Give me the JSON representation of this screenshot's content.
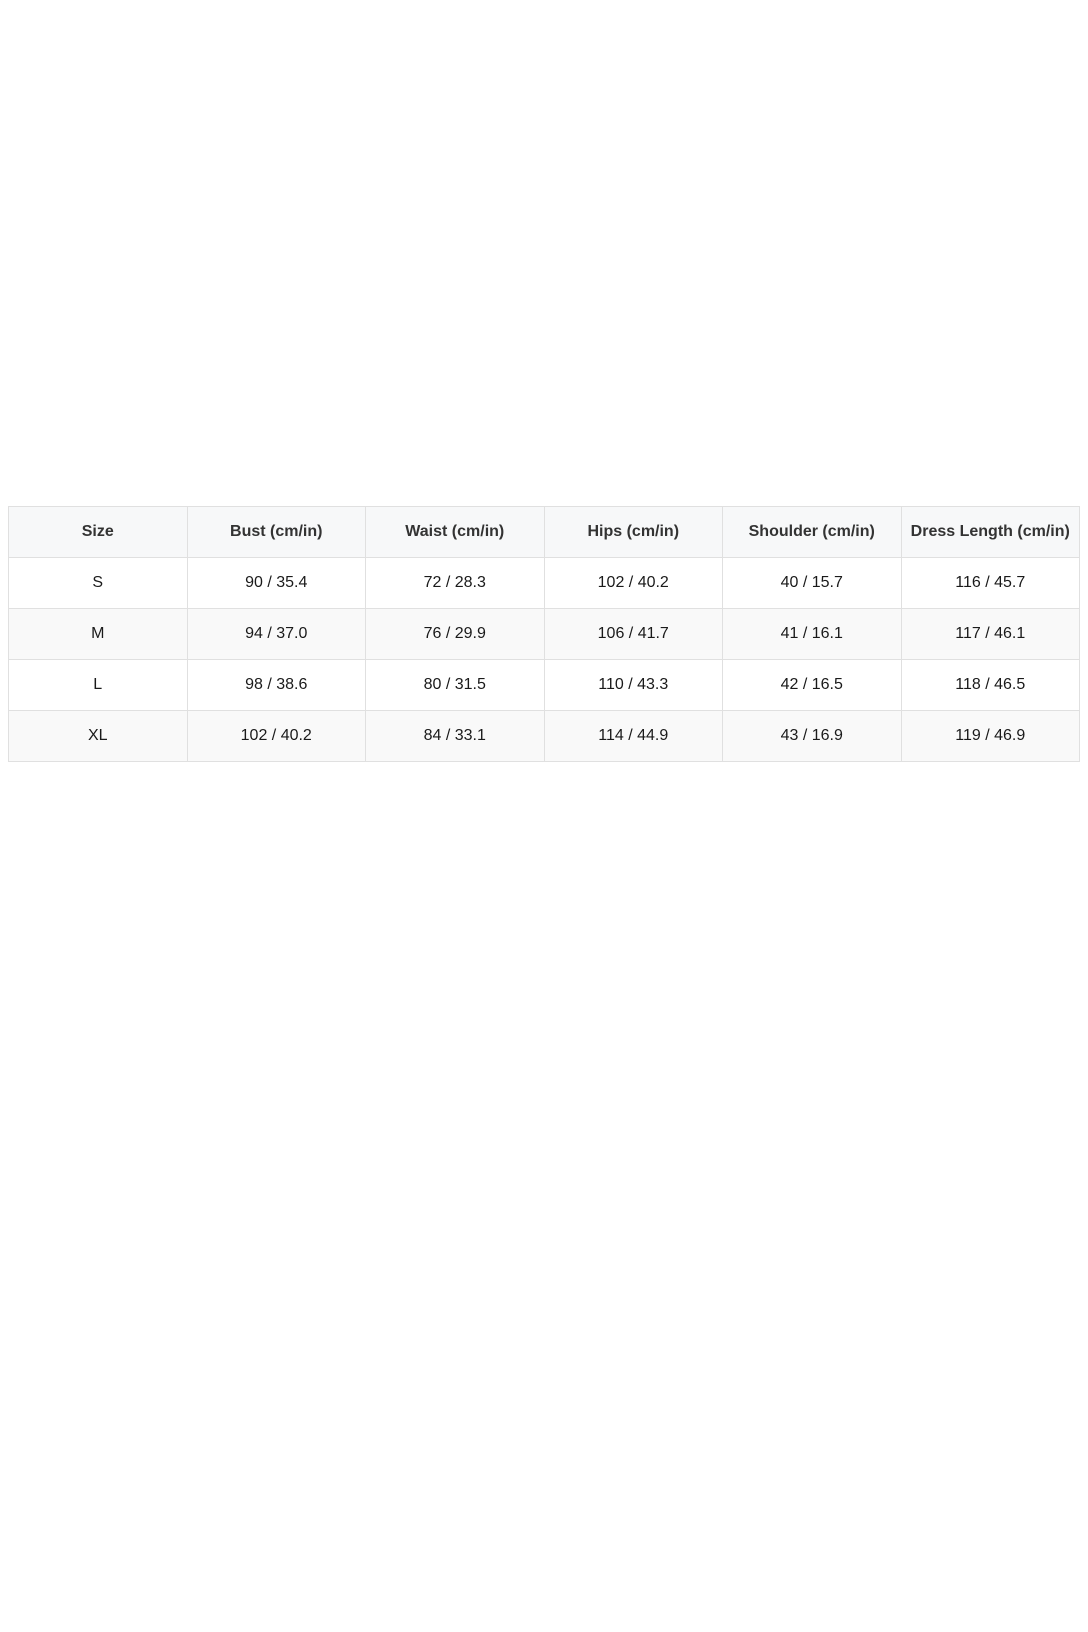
{
  "size_chart": {
    "headers": [
      "Size",
      "Bust (cm/in)",
      "Waist (cm/in)",
      "Hips (cm/in)",
      "Shoulder (cm/in)",
      "Dress Length (cm/in)"
    ],
    "rows": [
      [
        "S",
        "90 / 35.4",
        "72 / 28.3",
        "102 / 40.2",
        "40 / 15.7",
        "116 / 45.7"
      ],
      [
        "M",
        "94 / 37.0",
        "76 / 29.9",
        "106 / 41.7",
        "41 / 16.1",
        "117 / 46.1"
      ],
      [
        "L",
        "98 / 38.6",
        "80 / 31.5",
        "110 / 43.3",
        "42 / 16.5",
        "118 / 46.5"
      ],
      [
        "XL",
        "102 / 40.2",
        "84 / 33.1",
        "114 / 44.9",
        "43 / 16.9",
        "119 / 46.9"
      ]
    ]
  }
}
